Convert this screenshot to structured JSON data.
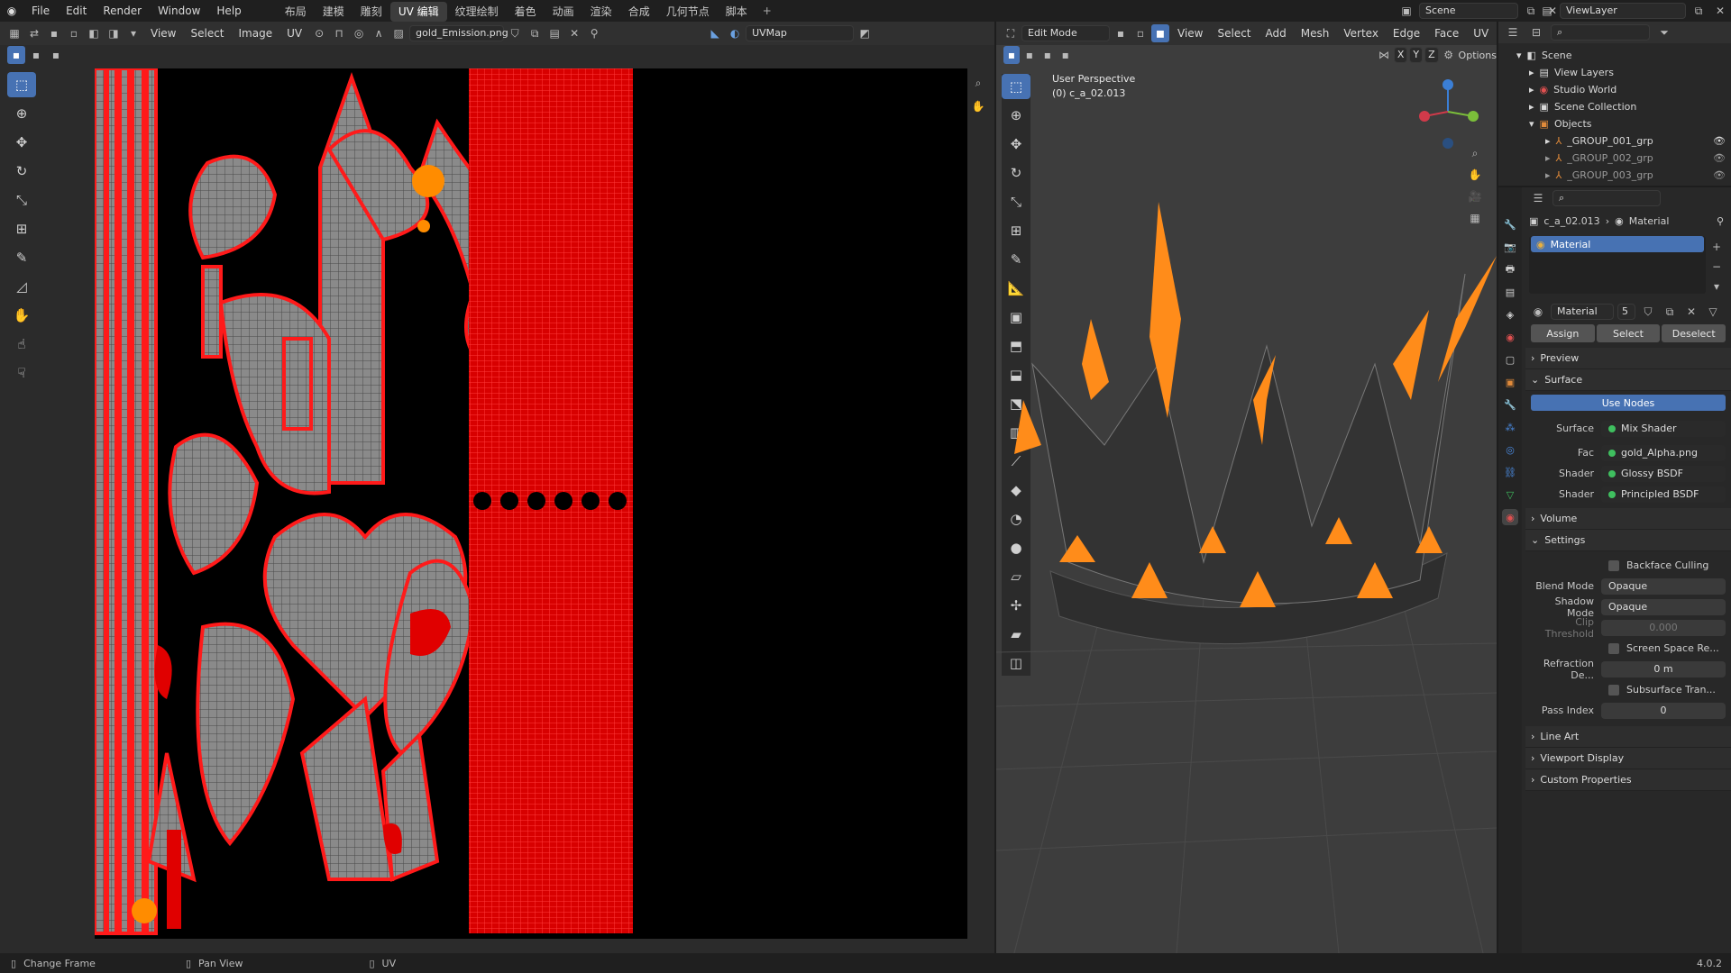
{
  "topbar": {
    "menus": [
      "File",
      "Edit",
      "Render",
      "Window",
      "Help"
    ],
    "workspaces": [
      "布局",
      "建模",
      "雕刻",
      "UV 编辑",
      "纹理绘制",
      "着色",
      "动画",
      "渲染",
      "合成",
      "几何节点",
      "脚本"
    ],
    "active_workspace": "UV 编辑",
    "scene_label": "Scene",
    "viewlayer_label": "ViewLayer"
  },
  "uv_editor": {
    "menus": [
      "View",
      "Select",
      "Image",
      "UV"
    ],
    "image_name": "gold_Emission.png",
    "uvmap_name": "UVMap"
  },
  "viewport": {
    "mode": "Edit Mode",
    "menus": [
      "View",
      "Select",
      "Add",
      "Mesh",
      "Vertex",
      "Edge",
      "Face",
      "UV"
    ],
    "options_label": "Options",
    "axes": [
      "X",
      "Y",
      "Z"
    ],
    "perspective_label": "User Perspective",
    "object_label": "(0) c_a_02.013"
  },
  "outliner": {
    "rows": [
      {
        "label": "Scene",
        "indent": 0,
        "icon": "scene-icon"
      },
      {
        "label": "View Layers",
        "indent": 1,
        "icon": "view-layers-icon"
      },
      {
        "label": "Studio World",
        "indent": 1,
        "icon": "world-icon"
      },
      {
        "label": "Scene Collection",
        "indent": 1,
        "icon": "collection-icon"
      },
      {
        "label": "Objects",
        "indent": 1,
        "icon": "objects-icon"
      },
      {
        "label": "_GROUP_001_grp",
        "indent": 2,
        "icon": "empty-icon"
      },
      {
        "label": "_GROUP_002_grp",
        "indent": 2,
        "icon": "empty-icon"
      },
      {
        "label": "_GROUP_003_grp",
        "indent": 2,
        "icon": "empty-icon"
      }
    ]
  },
  "properties": {
    "breadcrumb_object": "c_a_02.013",
    "breadcrumb_tab": "Material",
    "slot_name": "Material",
    "material_name": "Material",
    "users": "5",
    "buttons": {
      "assign": "Assign",
      "select": "Select",
      "deselect": "Deselect"
    },
    "sections": {
      "preview": "Preview",
      "surface": "Surface",
      "volume": "Volume",
      "settings": "Settings",
      "line_art": "Line Art",
      "viewport_display": "Viewport Display",
      "custom_props": "Custom Properties"
    },
    "use_nodes": "Use Nodes",
    "surface_rows": [
      {
        "label": "Surface",
        "value": "Mix Shader"
      },
      {
        "label": "Fac",
        "value": "gold_Alpha.png"
      },
      {
        "label": "Shader",
        "value": "Glossy BSDF"
      },
      {
        "label": "Shader",
        "value": "Principled BSDF"
      }
    ],
    "settings": {
      "backface_culling": "Backface Culling",
      "blend_mode_label": "Blend Mode",
      "blend_mode": "Opaque",
      "shadow_mode_label": "Shadow Mode",
      "shadow_mode": "Opaque",
      "clip_label": "Clip Threshold",
      "clip_value": "0.000",
      "ssr_label": "Screen Space Re...",
      "refraction_label": "Refraction De...",
      "refraction_value": "0 m",
      "sss_label": "Subsurface Tran...",
      "pass_index_label": "Pass Index",
      "pass_index": "0"
    }
  },
  "status": {
    "left": "Change Frame",
    "mid": "Pan View",
    "right": "UV",
    "version": "4.0.2"
  }
}
